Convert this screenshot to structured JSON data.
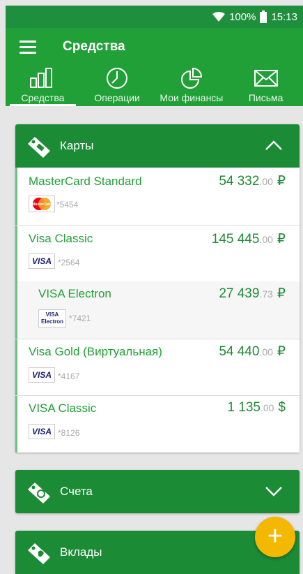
{
  "status_bar": {
    "battery": "100%",
    "time": "15:13"
  },
  "header": {
    "title": "Средства"
  },
  "tabs": [
    {
      "label": "Средства",
      "icon": "bar-chart-icon",
      "active": true
    },
    {
      "label": "Операции",
      "icon": "clock-icon",
      "active": false
    },
    {
      "label": "Мои финансы",
      "icon": "pie-chart-icon",
      "active": false
    },
    {
      "label": "Письма",
      "icon": "envelope-icon",
      "active": false
    }
  ],
  "sections": {
    "cards": {
      "title": "Карты",
      "expanded": true
    },
    "accounts": {
      "title": "Счета",
      "expanded": false
    },
    "deposits": {
      "title": "Вклады",
      "expanded": false
    }
  },
  "cards": [
    {
      "name": "MasterCard Standard",
      "amount": "54 332",
      "cents": ".00",
      "currency": "₽",
      "number": "*5454",
      "logo": "mastercard"
    },
    {
      "name": "Visa Classic",
      "amount": "145 445",
      "cents": ".00",
      "currency": "₽",
      "number": "*2564",
      "logo": "visa"
    },
    {
      "name": "VISA Electron",
      "amount": "27 439",
      "cents": ".73",
      "currency": "₽",
      "number": "*7421",
      "logo": "visa-electron",
      "logo_text": [
        "VISA",
        "Electron"
      ]
    },
    {
      "name": "Visa Gold (Виртуальная)",
      "amount": "54 440",
      "cents": ".00",
      "currency": "₽",
      "number": "*4167",
      "logo": "visa"
    },
    {
      "name": "VISA Classic",
      "amount": "1 135",
      "cents": ".00",
      "currency": "$",
      "number": "*8126",
      "logo": "visa"
    }
  ],
  "logo_labels": {
    "visa": "VISA",
    "mastercard": "MasterCard"
  },
  "colors": {
    "primary": "#21a038",
    "dark": "#1c8b36",
    "accent": "#f5b800"
  },
  "fab": {
    "symbol": "+"
  }
}
